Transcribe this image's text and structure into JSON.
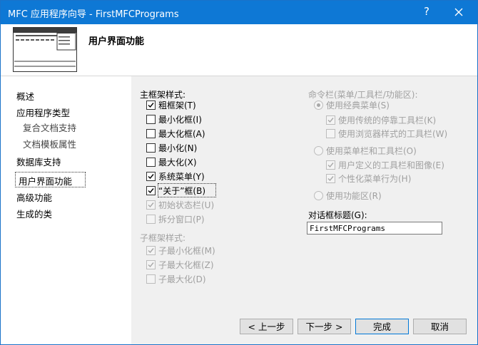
{
  "window": {
    "title": "MFC 应用程序向导 - FirstMFCPrograms",
    "help_label": "?",
    "close_label": "✕"
  },
  "header": {
    "heading": "用户界面功能"
  },
  "nav": {
    "items": [
      {
        "label": "概述"
      },
      {
        "label": "应用程序类型"
      },
      {
        "label": "复合文档支持"
      },
      {
        "label": "文档模板属性"
      },
      {
        "label": "数据库支持"
      },
      {
        "label": "用户界面功能"
      },
      {
        "label": "高级功能"
      },
      {
        "label": "生成的类"
      }
    ]
  },
  "main_frame": {
    "group_label": "主框架样式:",
    "options": [
      {
        "label": "粗框架(T)",
        "checked": true,
        "enabled": true
      },
      {
        "label": "最小化框(I)",
        "checked": false,
        "enabled": true
      },
      {
        "label": "最大化框(A)",
        "checked": false,
        "enabled": true
      },
      {
        "label": "最小化(N)",
        "checked": false,
        "enabled": true
      },
      {
        "label": "最大化(X)",
        "checked": false,
        "enabled": true
      },
      {
        "label": "系统菜单(Y)",
        "checked": true,
        "enabled": true
      },
      {
        "label": "“关于”框(B)",
        "checked": true,
        "enabled": true
      },
      {
        "label": "初始状态栏(U)",
        "checked": true,
        "enabled": false
      },
      {
        "label": "拆分窗口(P)",
        "checked": false,
        "enabled": false
      }
    ]
  },
  "child_frame": {
    "group_label": "子框架样式:",
    "options": [
      {
        "label": "子最小化框(M)",
        "checked": true,
        "enabled": false
      },
      {
        "label": "子最大化框(Z)",
        "checked": true,
        "enabled": false
      },
      {
        "label": "子最大化(D)",
        "checked": false,
        "enabled": false
      }
    ]
  },
  "command_bar": {
    "group_label": "命令栏(菜单/工具栏/功能区):",
    "radio_classic": "使用经典菜单(S)",
    "classic_options": [
      {
        "label": "使用传统的停靠工具栏(K)",
        "checked": true
      },
      {
        "label": "使用浏览器样式的工具栏(W)",
        "checked": false
      }
    ],
    "radio_menubar": "使用菜单栏和工具栏(O)",
    "menubar_options": [
      {
        "label": "用户定义的工具栏和图像(E)",
        "checked": true
      },
      {
        "label": "个性化菜单行为(H)",
        "checked": true
      }
    ],
    "radio_ribbon": "使用功能区(R)"
  },
  "dialog_title": {
    "label": "对话框标题(G):",
    "value": "FirstMFCPrograms"
  },
  "buttons": {
    "prev": "< 上一步",
    "next": "下一步 >",
    "finish": "完成",
    "cancel": "取消"
  }
}
